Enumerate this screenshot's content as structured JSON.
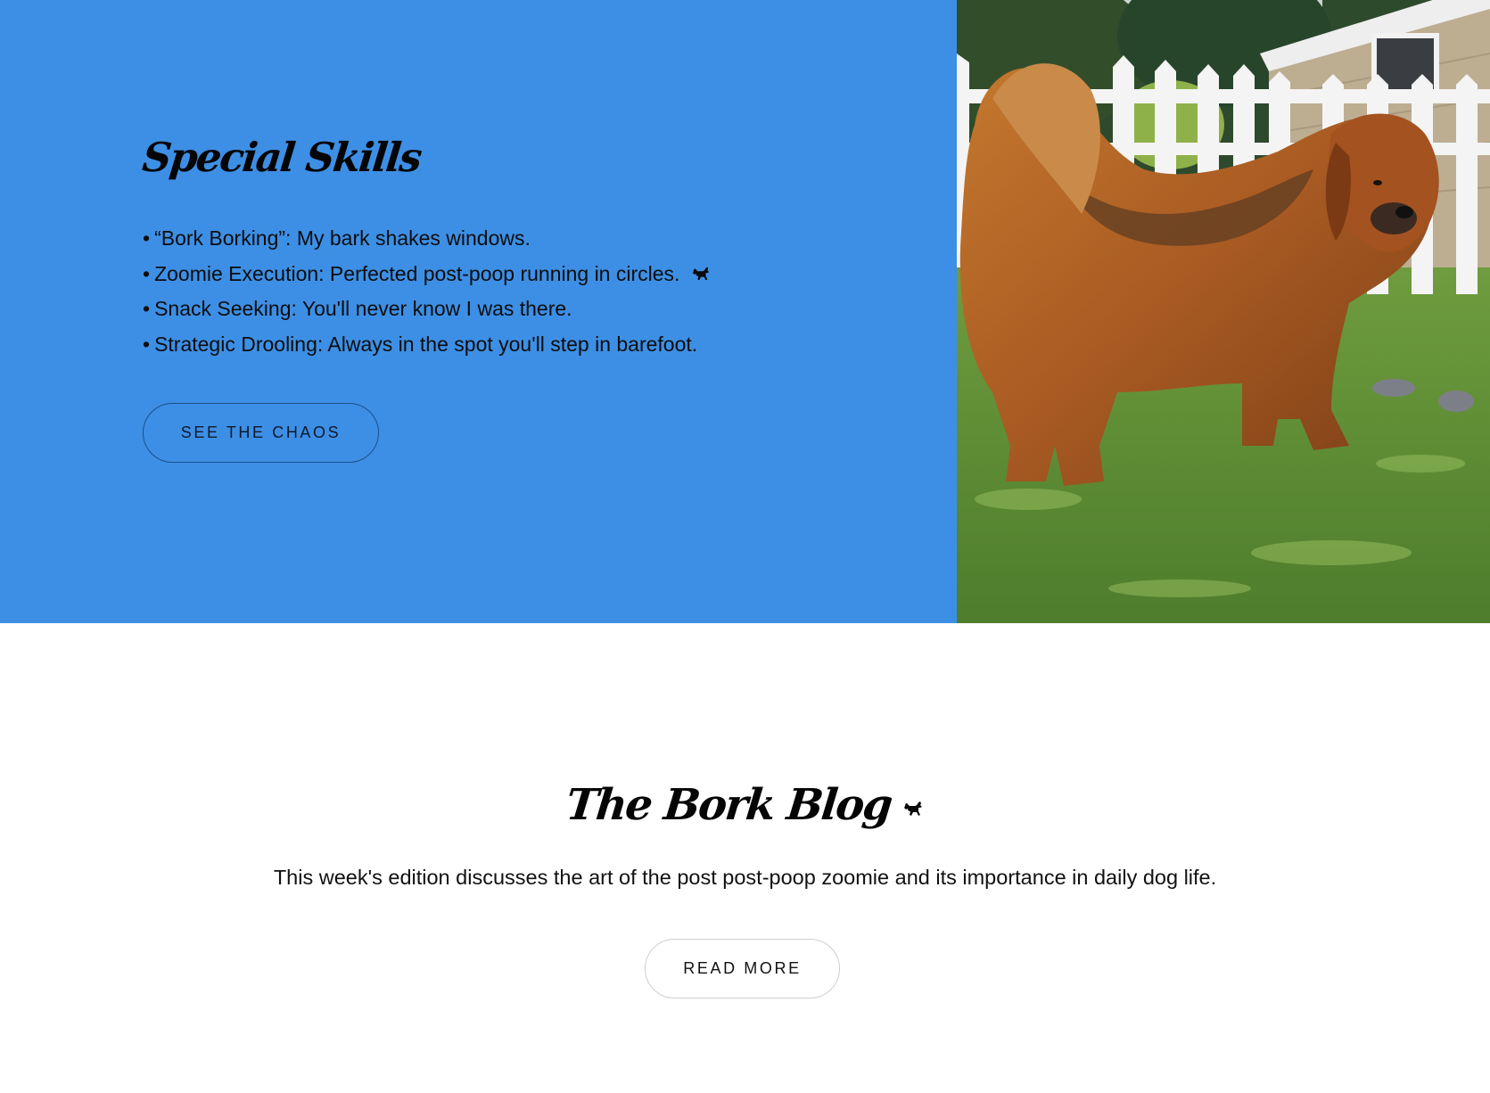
{
  "skills": {
    "title": "Special Skills",
    "items": [
      {
        "bullet": "•",
        "text": "“Bork Borking”: My bark shakes windows."
      },
      {
        "bullet": "•",
        "text": "Zoomie Execution: Perfected post-poop running in circles.",
        "icon": "dog-running-icon"
      },
      {
        "bullet": "•",
        "text": "Snack Seeking: You'll never know I was there."
      },
      {
        "bullet": "•",
        "text": "Strategic Drooling: Always in the spot you'll step in barefoot."
      }
    ],
    "button_label": "SEE THE CHAOS",
    "panel_color": "#3d8fe5"
  },
  "photo": {
    "alt": "Fluffy red-brown dog standing on grass by a white picket fence"
  },
  "blog": {
    "title": "The Bork Blog",
    "title_icon": "dog-running-icon",
    "description": "This week's edition discusses the art of the post post-poop zoomie and its importance in daily dog life.",
    "button_label": "READ MORE"
  }
}
